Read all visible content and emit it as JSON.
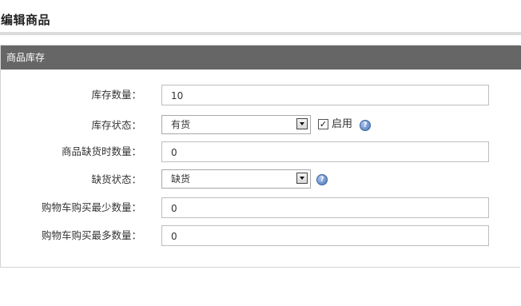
{
  "page": {
    "title": "编辑商品"
  },
  "panel": {
    "header": "商品库存"
  },
  "form": {
    "stock_quantity": {
      "label": "库存数量：",
      "value": "10"
    },
    "stock_status": {
      "label": "库存状态：",
      "selected": "有货",
      "checkbox_checked": true,
      "checkbox_mark": "✓",
      "checkbox_label": "启用",
      "help_glyph": "?"
    },
    "out_of_stock_quantity": {
      "label": "商品缺货时数量：",
      "value": "0"
    },
    "out_of_stock_status": {
      "label": "缺货状态：",
      "selected": "缺货",
      "help_glyph": "?"
    },
    "min_purchase": {
      "label": "购物车购买最少数量：",
      "value": "0"
    },
    "max_purchase": {
      "label": "购物车购买最多数量：",
      "value": "0"
    }
  },
  "colors": {
    "panel_header_bg": "#666666",
    "help_icon": "#4a76b8"
  }
}
